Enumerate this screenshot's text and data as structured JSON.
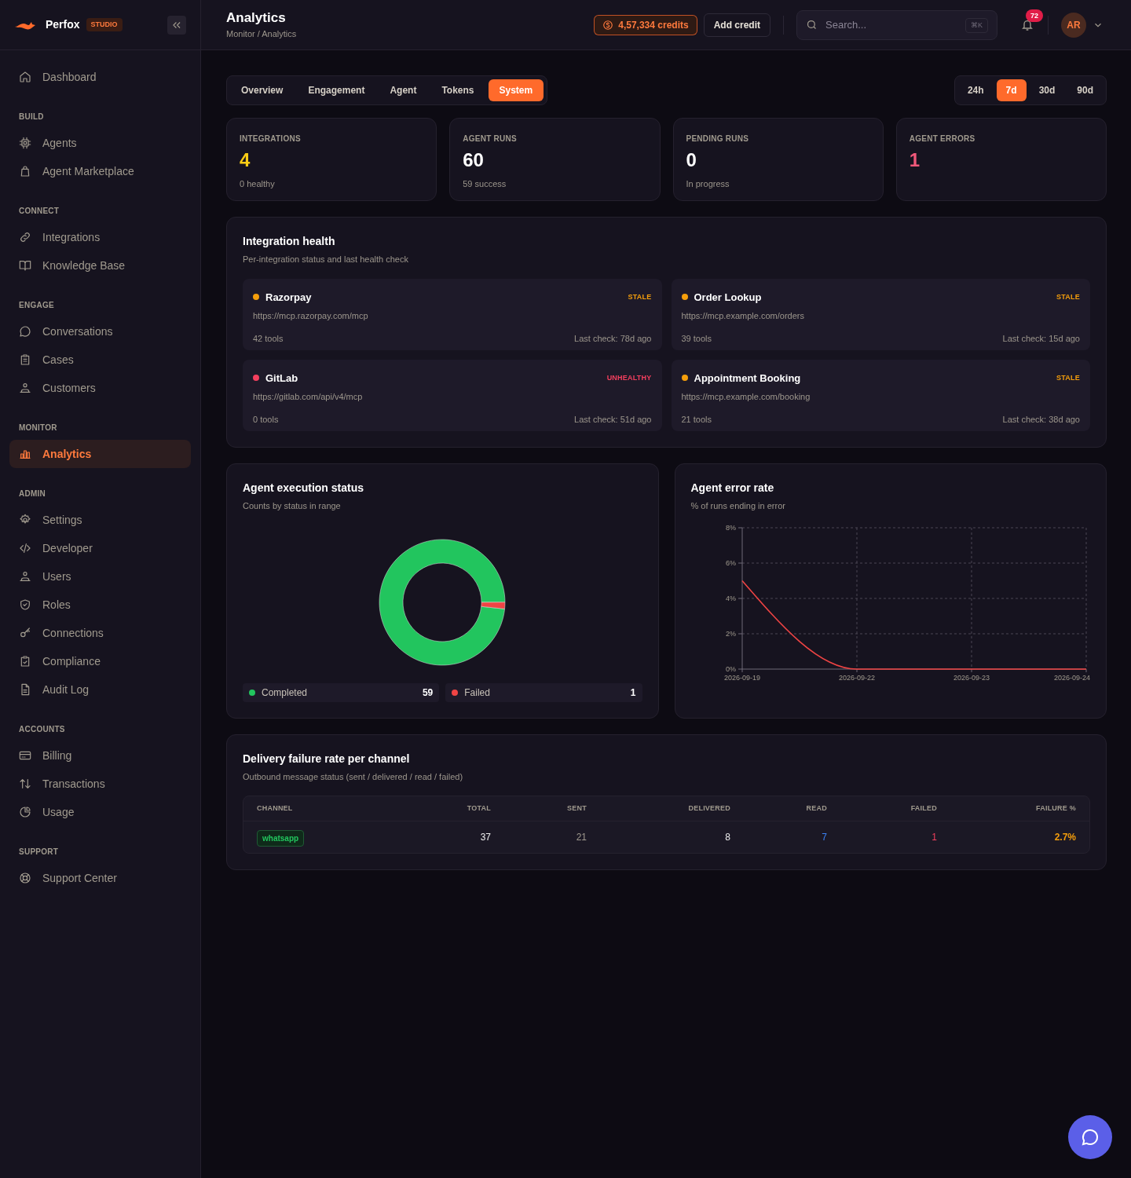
{
  "brand": {
    "name": "Perfox",
    "badge": "STUDIO"
  },
  "sidebar": {
    "items": [
      {
        "label": "Dashboard",
        "selected": false
      }
    ],
    "sections": [
      {
        "heading": "BUILD",
        "items": [
          {
            "label": "Agents",
            "selected": false
          },
          {
            "label": "Agent Marketplace",
            "selected": false
          }
        ]
      },
      {
        "heading": "CONNECT",
        "items": [
          {
            "label": "Integrations",
            "selected": false
          },
          {
            "label": "Knowledge Base",
            "selected": false
          }
        ]
      },
      {
        "heading": "ENGAGE",
        "items": [
          {
            "label": "Conversations",
            "selected": false
          },
          {
            "label": "Cases",
            "selected": false
          },
          {
            "label": "Customers",
            "selected": false
          }
        ]
      },
      {
        "heading": "MONITOR",
        "items": [
          {
            "label": "Analytics",
            "selected": true
          }
        ]
      },
      {
        "heading": "ADMIN",
        "items": [
          {
            "label": "Settings",
            "selected": false
          },
          {
            "label": "Developer",
            "selected": false
          },
          {
            "label": "Users",
            "selected": false
          },
          {
            "label": "Roles",
            "selected": false
          },
          {
            "label": "Connections",
            "selected": false
          },
          {
            "label": "Compliance",
            "selected": false
          },
          {
            "label": "Audit Log",
            "selected": false
          }
        ]
      },
      {
        "heading": "ACCOUNTS",
        "items": [
          {
            "label": "Billing",
            "selected": false
          },
          {
            "label": "Transactions",
            "selected": false
          },
          {
            "label": "Usage",
            "selected": false
          }
        ]
      },
      {
        "heading": "SUPPORT",
        "items": [
          {
            "label": "Support Center",
            "selected": false
          }
        ]
      }
    ]
  },
  "header": {
    "title": "Analytics",
    "breadcrumb": "Monitor / Analytics",
    "credits": "4,57,334 credits",
    "add_credit": "Add credit",
    "search": {
      "placeholder": "Search...",
      "shortcut": "⌘K"
    },
    "notifications": "72",
    "avatar": "AR"
  },
  "tabs": [
    {
      "label": "Overview",
      "selected": false
    },
    {
      "label": "Engagement",
      "selected": false
    },
    {
      "label": "Agent",
      "selected": false
    },
    {
      "label": "Tokens",
      "selected": false
    },
    {
      "label": "System",
      "selected": true
    }
  ],
  "ranges": [
    {
      "label": "24h",
      "selected": false
    },
    {
      "label": "7d",
      "selected": true
    },
    {
      "label": "30d",
      "selected": false
    },
    {
      "label": "90d",
      "selected": false
    }
  ],
  "stats": [
    {
      "label": "INTEGRATIONS",
      "value": "4",
      "sub": "0 healthy",
      "color": "#facc15"
    },
    {
      "label": "AGENT RUNS",
      "value": "60",
      "sub": "59 success",
      "color": "#ffffff"
    },
    {
      "label": "PENDING RUNS",
      "value": "0",
      "sub": "In progress",
      "color": "#ffffff"
    },
    {
      "label": "AGENT ERRORS",
      "value": "1",
      "color": "#f0587a"
    }
  ],
  "integration_health": {
    "title": "Integration health",
    "subtitle": "Per-integration status and last health check",
    "items": [
      {
        "name": "Razorpay",
        "status": "STALE",
        "url": "https://mcp.razorpay.com/mcp",
        "tools": "42 tools",
        "last_check": "Last check: 78d ago",
        "color": "#f59e0b"
      },
      {
        "name": "Order Lookup",
        "status": "STALE",
        "url": "https://mcp.example.com/orders",
        "tools": "39 tools",
        "last_check": "Last check: 15d ago",
        "color": "#f59e0b"
      },
      {
        "name": "GitLab",
        "status": "UNHEALTHY",
        "url": "https://gitlab.com/api/v4/mcp",
        "tools": "0 tools",
        "last_check": "Last check: 51d ago",
        "color": "#f43f5e"
      },
      {
        "name": "Appointment Booking",
        "status": "STALE",
        "url": "https://mcp.example.com/booking",
        "tools": "21 tools",
        "last_check": "Last check: 38d ago",
        "color": "#f59e0b"
      }
    ]
  },
  "execution_status": {
    "title": "Agent execution status",
    "subtitle": "Counts by status in range",
    "chart_data": {
      "type": "donut",
      "categories": [
        "Completed",
        "Failed"
      ],
      "values": [
        98.3,
        1.7
      ]
    },
    "legend": [
      {
        "value": "59",
        "color": "#22c55e"
      },
      {
        "value": "1",
        "color": "#ef4444"
      }
    ]
  },
  "error_rate": {
    "title": "Agent error rate",
    "subtitle": "% of runs ending in error",
    "chart_data": {
      "type": "line",
      "x": [
        "2026-09-19",
        "2026-09-22",
        "2026-09-23",
        "2026-09-24"
      ],
      "series": [
        {
          "color": "#ef4444",
          "values": [
            5,
            0,
            0,
            0
          ]
        }
      ],
      "ylim": [
        0,
        8
      ],
      "grid": true,
      "yticks": [
        {
          "value": 0,
          "label": "0%"
        },
        {
          "value": 2,
          "label": "2%"
        },
        {
          "value": 4,
          "label": "4%"
        },
        {
          "value": 6,
          "label": "6%"
        },
        {
          "value": 8,
          "label": "8%"
        }
      ]
    }
  },
  "delivery": {
    "title": "Delivery failure rate per channel",
    "subtitle": "Outbound message status (sent / delivered / read / failed)",
    "columns": [
      "CHANNEL",
      "TOTAL",
      "SENT",
      "DELIVERED",
      "READ",
      "FAILED",
      "FAILURE %"
    ],
    "rows": [
      {
        "channel": "whatsapp",
        "total": "37",
        "sent": "21",
        "delivered": "8",
        "read": "7",
        "failed": "1",
        "failure_pct": "2.7%"
      }
    ]
  }
}
